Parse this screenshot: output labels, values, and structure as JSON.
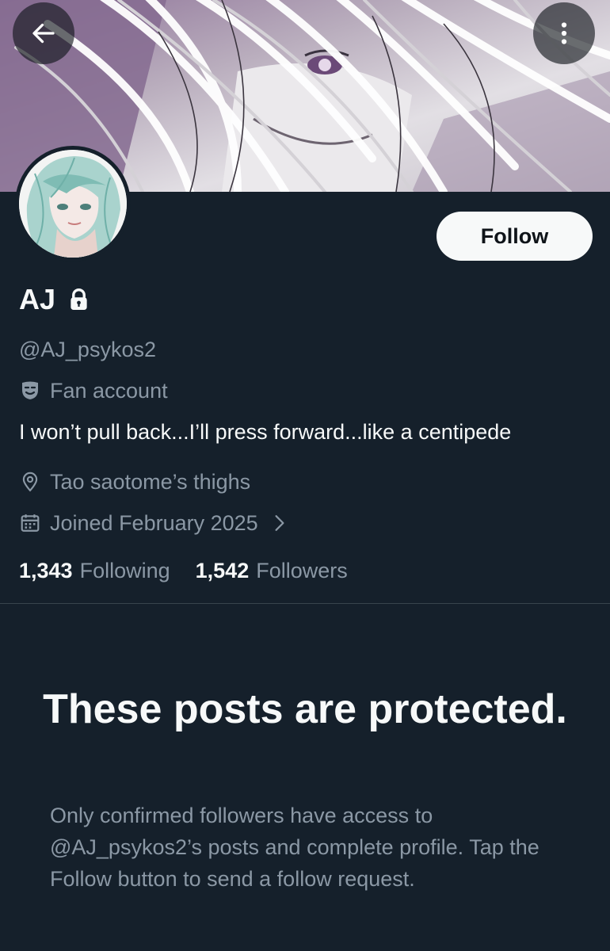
{
  "header": {
    "back_icon": "arrow-left-icon",
    "more_icon": "more-vertical-icon"
  },
  "profile": {
    "display_name": "AJ",
    "protected_icon": "lock-icon",
    "handle": "@AJ_psykos2",
    "category_icon": "theater-masks-icon",
    "category": "Fan account",
    "bio": "I won’t pull back...I’ll press forward...like a centipede",
    "location_icon": "map-pin-icon",
    "location": "Tao saotome’s thighs",
    "joined_icon": "calendar-icon",
    "joined": "Joined February 2025",
    "following_count": "1,343",
    "following_label": "Following",
    "followers_count": "1,542",
    "followers_label": "Followers"
  },
  "actions": {
    "follow_label": "Follow"
  },
  "protected_notice": {
    "title": "These posts are protected.",
    "body": "Only confirmed followers have access to @AJ_psykos2’s posts and complete profile. Tap the Follow button to send a follow request."
  },
  "colors": {
    "background": "#15202b",
    "text_primary": "#f7f9f9",
    "text_secondary": "#8b98a5",
    "divider": "#38444d",
    "banner_accent": "#8a6e95"
  }
}
